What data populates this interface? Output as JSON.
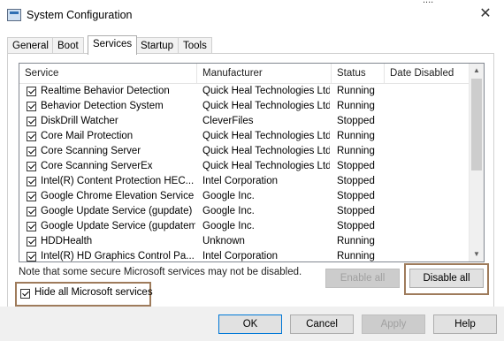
{
  "window": {
    "title": "System Configuration",
    "stray_text": "...."
  },
  "tabs": [
    {
      "label": "General"
    },
    {
      "label": "Boot"
    },
    {
      "label": "Services"
    },
    {
      "label": "Startup"
    },
    {
      "label": "Tools"
    }
  ],
  "active_tab": "Services",
  "columns": [
    "Service",
    "Manufacturer",
    "Status",
    "Date Disabled"
  ],
  "services": [
    {
      "checked": true,
      "name": "Realtime Behavior Detection",
      "manufacturer": "Quick Heal Technologies Ltd.",
      "status": "Running",
      "date_disabled": ""
    },
    {
      "checked": true,
      "name": "Behavior Detection System",
      "manufacturer": "Quick Heal Technologies Ltd.",
      "status": "Running",
      "date_disabled": ""
    },
    {
      "checked": true,
      "name": "DiskDrill Watcher",
      "manufacturer": "CleverFiles",
      "status": "Stopped",
      "date_disabled": ""
    },
    {
      "checked": true,
      "name": "Core Mail Protection",
      "manufacturer": "Quick Heal Technologies Ltd.",
      "status": "Running",
      "date_disabled": ""
    },
    {
      "checked": true,
      "name": "Core Scanning Server",
      "manufacturer": "Quick Heal Technologies Ltd.",
      "status": "Running",
      "date_disabled": ""
    },
    {
      "checked": true,
      "name": "Core Scanning ServerEx",
      "manufacturer": "Quick Heal Technologies Ltd.",
      "status": "Stopped",
      "date_disabled": ""
    },
    {
      "checked": true,
      "name": "Intel(R) Content Protection HEC...",
      "manufacturer": "Intel Corporation",
      "status": "Stopped",
      "date_disabled": ""
    },
    {
      "checked": true,
      "name": "Google Chrome Elevation Service",
      "manufacturer": "Google Inc.",
      "status": "Stopped",
      "date_disabled": ""
    },
    {
      "checked": true,
      "name": "Google Update Service (gupdate)",
      "manufacturer": "Google Inc.",
      "status": "Stopped",
      "date_disabled": ""
    },
    {
      "checked": true,
      "name": "Google Update Service (gupdatem)",
      "manufacturer": "Google Inc.",
      "status": "Stopped",
      "date_disabled": ""
    },
    {
      "checked": true,
      "name": "HDDHealth",
      "manufacturer": "Unknown",
      "status": "Running",
      "date_disabled": ""
    },
    {
      "checked": true,
      "name": "Intel(R) HD Graphics Control Pa...",
      "manufacturer": "Intel Corporation",
      "status": "Running",
      "date_disabled": ""
    }
  ],
  "note": "Note that some secure Microsoft services may not be disabled.",
  "buttons": {
    "enable_all": "Enable all",
    "disable_all": "Disable all",
    "ok": "OK",
    "cancel": "Cancel",
    "apply": "Apply",
    "help": "Help"
  },
  "hide_ms": {
    "checked": true,
    "label": "Hide all Microsoft services"
  },
  "highlight_color": "#9e7b5b",
  "accent_color": "#0078d7"
}
